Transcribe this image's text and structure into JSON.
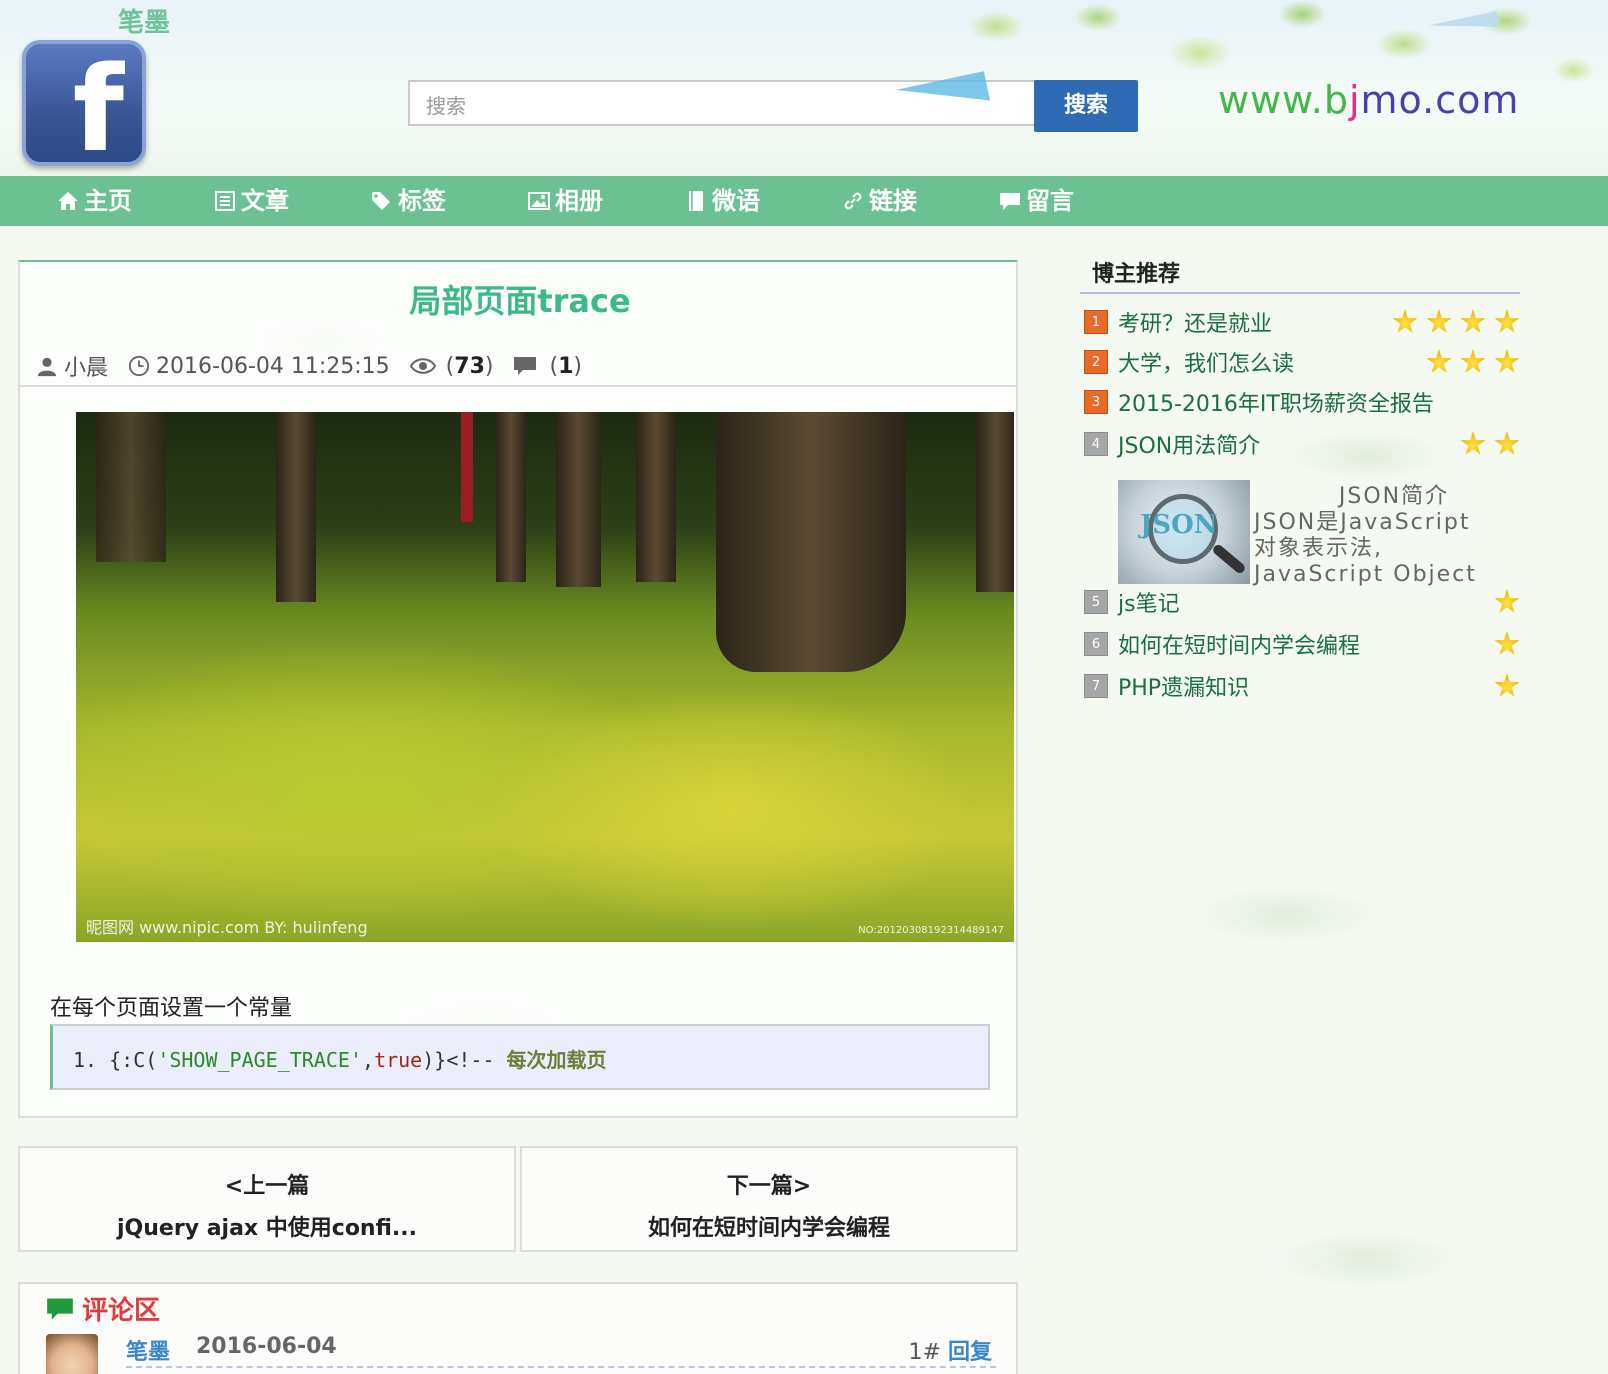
{
  "header": {
    "site_name": "笔墨",
    "search_placeholder": "搜索",
    "search_button": "搜索",
    "brand_url": "www.bjmo.com",
    "brand_parts": [
      "www.b",
      "j",
      "mo.com"
    ]
  },
  "nav": {
    "items": [
      {
        "label": "主页",
        "icon": "home-icon"
      },
      {
        "label": "文章",
        "icon": "list-icon"
      },
      {
        "label": "标签",
        "icon": "tags-icon"
      },
      {
        "label": "相册",
        "icon": "picture-icon"
      },
      {
        "label": "微语",
        "icon": "book-icon"
      },
      {
        "label": "链接",
        "icon": "link-icon"
      },
      {
        "label": "留言",
        "icon": "comment-icon"
      }
    ]
  },
  "article": {
    "title": "局部页面trace",
    "author": "小晨",
    "datetime": "2016-06-04 11:25:15",
    "views": "73",
    "comments": "1",
    "photo_watermark": "昵图网 www.nipic.com  BY: hulinfeng",
    "photo_id": "NO:20120308192314489147",
    "text": "在每个页面设置一个常量",
    "code": {
      "line_no": "1.",
      "prefix": "{:C(",
      "arg1": "'SHOW_PAGE_TRACE'",
      "comma": ",",
      "arg2": "true",
      "suffix": ")}<!-- ",
      "comment": "每次加载页"
    }
  },
  "pager": {
    "prev_label": "<上一篇",
    "prev_title": "jQuery ajax 中使用confi...",
    "next_label": "下一篇>",
    "next_title": "如何在短时间内学会编程"
  },
  "comments": {
    "title": "评论区",
    "items": [
      {
        "user": "笔墨",
        "date": "2016-06-04",
        "floor": "1#",
        "reply": "回复"
      }
    ]
  },
  "sidebar": {
    "title": "博主推荐",
    "items": [
      {
        "num": "1",
        "title": "考研？还是就业",
        "stars": 4,
        "badge": "orange"
      },
      {
        "num": "2",
        "title": "大学，我们怎么读",
        "stars": 3,
        "badge": "orange"
      },
      {
        "num": "3",
        "title": "2015-2016年IT职场薪资全报告",
        "stars": 0,
        "badge": "orange"
      },
      {
        "num": "4",
        "title": "JSON用法简介",
        "stars": 2,
        "badge": "gray"
      },
      {
        "num": "5",
        "title": "js笔记",
        "stars": 1,
        "badge": "gray"
      },
      {
        "num": "6",
        "title": "如何在短时间内学会编程",
        "stars": 1,
        "badge": "gray"
      },
      {
        "num": "7",
        "title": "PHP遗漏知识",
        "stars": 1,
        "badge": "gray"
      }
    ],
    "json_card": {
      "image_word": "JSON",
      "line1": "JSON简介",
      "line2": "JSON是JavaScript",
      "line3": "对象表示法,",
      "line4": "JavaScript Object"
    }
  },
  "colors": {
    "nav_bg": "#6cc192",
    "title_green": "#3db88a",
    "search_button": "#2f6bb4",
    "comment_title": "#e23a3a",
    "badge_orange": "#ea6a2a",
    "badge_gray": "#a6a6a6",
    "link_green": "#1a6f3e"
  }
}
